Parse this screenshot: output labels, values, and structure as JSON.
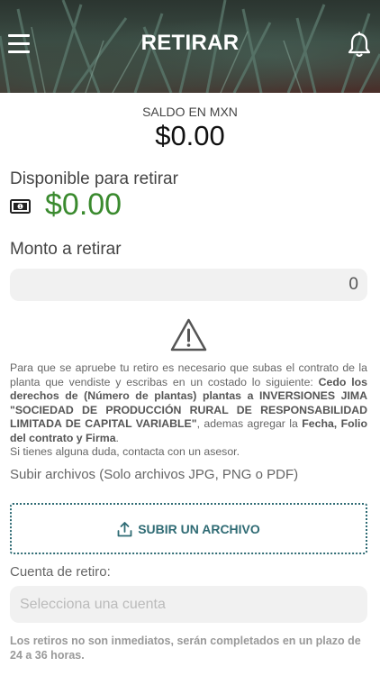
{
  "header": {
    "title": "RETIRAR",
    "menu_icon": "hamburger-menu-icon",
    "bell_icon": "bell-icon"
  },
  "balance": {
    "label": "SALDO EN MXN",
    "value": "$0.00"
  },
  "available": {
    "label": "Disponible para retirar",
    "icon": "cash-icon",
    "value": "$0.00",
    "color": "#3a8a2e"
  },
  "amount": {
    "label": "Monto a retirar",
    "value": "0"
  },
  "notice": {
    "icon": "warning-icon",
    "intro": "Para que se apruebe tu retiro es necesario que subas el contrato de la planta que vendiste y escribas en un costado lo siguiente: ",
    "bold_text": "Cedo los derechos de (Número de plantas) plantas a INVERSIONES JIMA \"SOCIEDAD DE PRODUCCIÓN RURAL DE RESPONSABILIDAD LIMITADA DE CAPITAL VARIABLE\"",
    "mid": ", ademas agregar la ",
    "bold_fields": "Fecha, Folio del contrato y Firma",
    "end": ".",
    "help": "Si tienes alguna duda, contacta con un asesor."
  },
  "upload": {
    "label": "Subir archivos (Solo archivos JPG, PNG o PDF)",
    "button_label": "SUBIR UN ARCHIVO",
    "icon": "upload-icon",
    "accent": "#2f6b74"
  },
  "account": {
    "label": "Cuenta de retiro:",
    "placeholder": "Selecciona una cuenta"
  },
  "footnote": "Los retiros no son inmediatos, serán completados en un plazo de 24 a 36 horas."
}
